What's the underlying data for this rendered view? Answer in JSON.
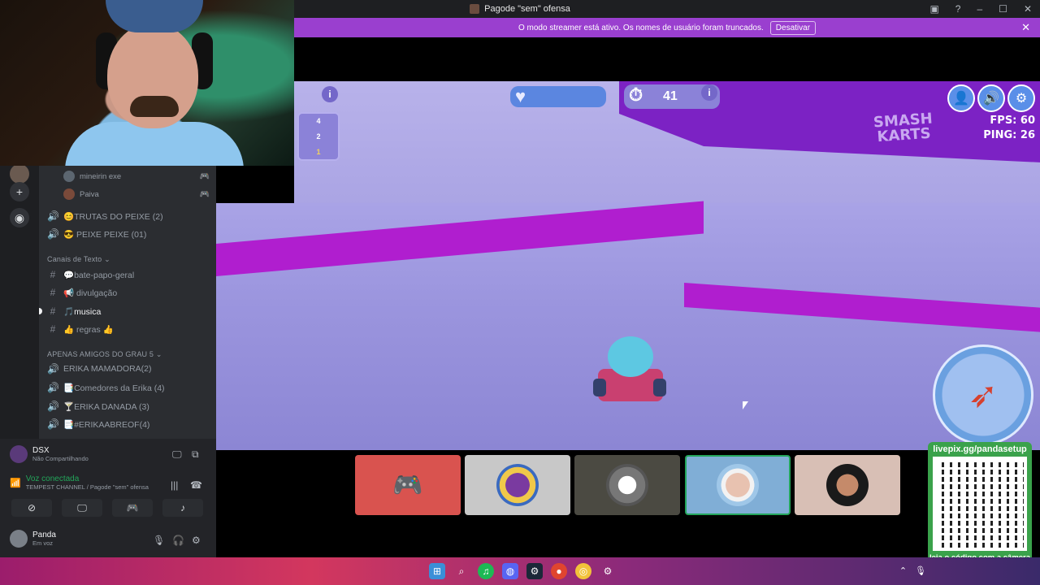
{
  "window": {
    "title": "Pagode \"sem\" ofensa"
  },
  "banner": {
    "text": "O modo streamer está ativo. Os nomes de usuário foram truncados.",
    "button": "Desativar"
  },
  "voice_members": [
    {
      "name": "mineirin exe"
    },
    {
      "name": "Paiva"
    }
  ],
  "channels": {
    "voice_top": [
      {
        "label": "😊TRUTAS DO PEIXE (2)"
      },
      {
        "label": "😎 PEIXE PEIXE (01)"
      }
    ],
    "text_category": "Canais de Texto",
    "text_channels": [
      {
        "label": "💬bate-papo-geral"
      },
      {
        "label": "📢 divulgação"
      },
      {
        "label": "🎵musica"
      },
      {
        "label": "👍 regras 👍"
      }
    ],
    "friends_category": "APENAS AMIGOS DO GRAU 5",
    "friends_channels": [
      {
        "label": "ERIKA MAMADORA(2)"
      },
      {
        "label": "📑Comedores da Erika (4)"
      },
      {
        "label": "🍸ERIKA DANADA (3)"
      },
      {
        "label": "📑#ERIKAABREOF(4)"
      }
    ]
  },
  "stream": {
    "name": "DSX",
    "status": "Não Compartilhando"
  },
  "voice": {
    "status": "Voz conectada",
    "channel": "TEMPEST CHANNEL / Pagode \"sem\" ofensa"
  },
  "user": {
    "name": "Panda",
    "status": "Em voz"
  },
  "game": {
    "place": "4",
    "timer": "41",
    "fps": "FPS: 60",
    "ping": "PING: 26",
    "minimap": [
      "4",
      "2",
      "1"
    ],
    "logo": "SMASH KARTS"
  },
  "participants": [
    {
      "kind": "discord",
      "color": "#d9534f"
    },
    {
      "kind": "avatar",
      "color": "#c8c8c8"
    },
    {
      "kind": "avatar",
      "color": "#4b4a42"
    },
    {
      "kind": "avatar",
      "color": "#80aed6"
    },
    {
      "kind": "avatar",
      "color": "#d8bfb5"
    }
  ],
  "qr": {
    "url": "livepix.gg/pandasetup",
    "caption": "leia o código com a câmera do celular."
  },
  "colors": {
    "accent": "#9a3fcf",
    "voice_green": "#23a55a",
    "qr_green": "#3aa24b"
  }
}
